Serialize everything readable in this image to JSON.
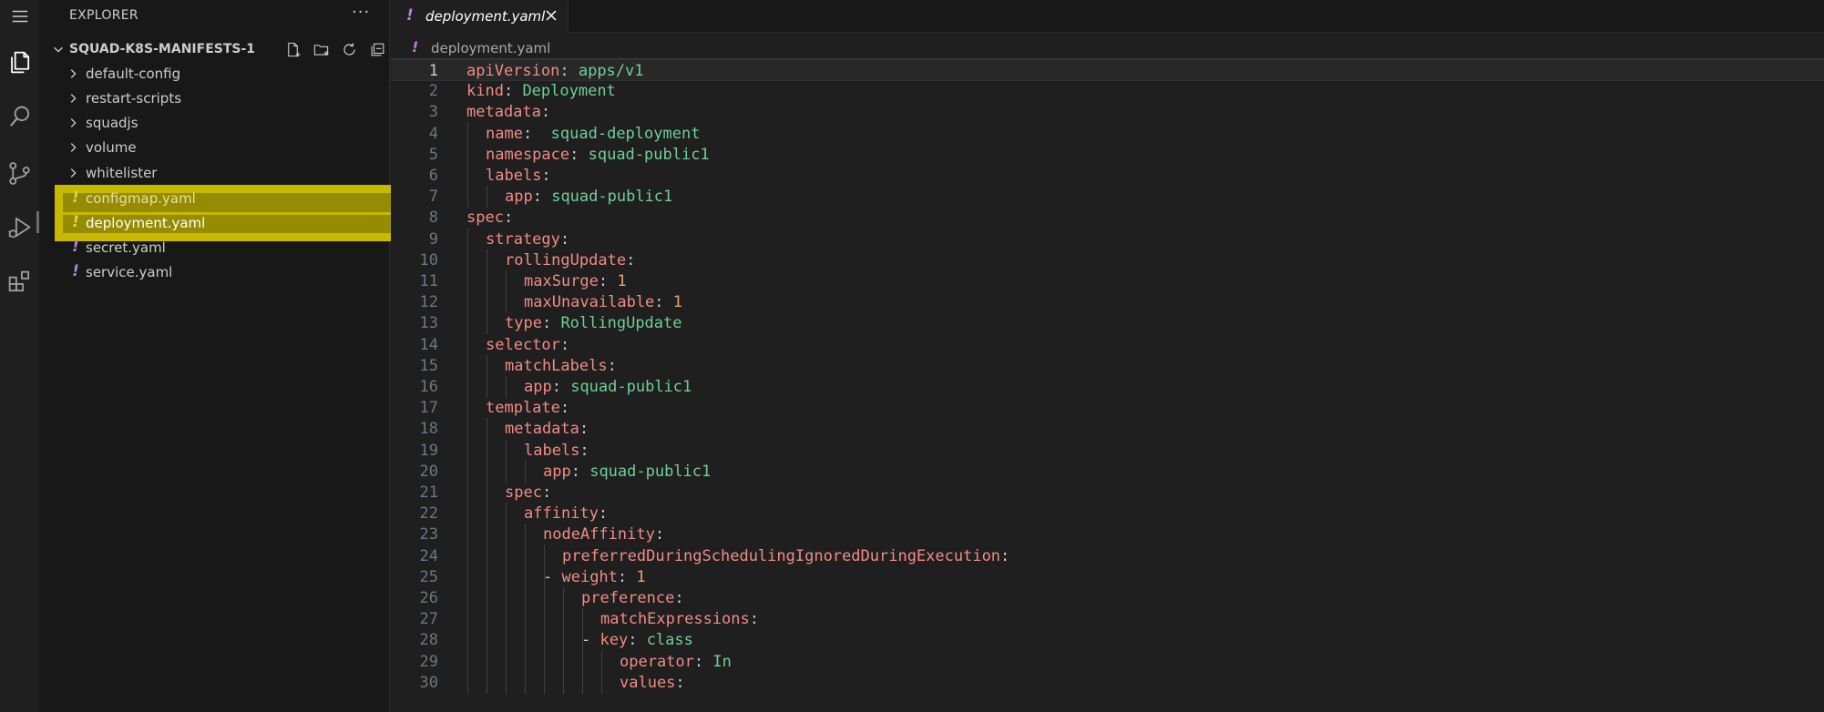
{
  "sidebar": {
    "title": "EXPLORER",
    "more": "···",
    "workspace": "SQUAD-K8S-MANIFESTS-1",
    "folders": [
      "default-config",
      "restart-scripts",
      "squadjs",
      "volume",
      "whitelister"
    ],
    "files": [
      {
        "icon": "!",
        "name": "configmap.yaml"
      },
      {
        "icon": "!",
        "name": "deployment.yaml"
      },
      {
        "icon": "!",
        "name": "secret.yaml"
      },
      {
        "icon": "!",
        "name": "service.yaml"
      }
    ]
  },
  "editor": {
    "tab_title": "deployment.yaml",
    "tab_icon": "!",
    "breadcrumb": "deployment.yaml",
    "lines": [
      {
        "num": "1",
        "key": "apiVersion",
        "val": "apps/v1"
      },
      {
        "num": "2",
        "key": "kind",
        "val": "Deployment"
      },
      {
        "num": "3",
        "key": "metadata",
        "val": ""
      },
      {
        "num": "4",
        "key": "name",
        "val": " squad-deployment"
      },
      {
        "num": "5",
        "key": "namespace",
        "val": "squad-public1"
      },
      {
        "num": "6",
        "key": "labels",
        "val": ""
      },
      {
        "num": "7",
        "key": "app",
        "val": "squad-public1"
      },
      {
        "num": "8",
        "key": "spec",
        "val": ""
      },
      {
        "num": "9",
        "key": "strategy",
        "val": ""
      },
      {
        "num": "10",
        "key": "rollingUpdate",
        "val": ""
      },
      {
        "num": "11",
        "key": "maxSurge",
        "val": "1"
      },
      {
        "num": "12",
        "key": "maxUnavailable",
        "val": "1"
      },
      {
        "num": "13",
        "key": "type",
        "val": "RollingUpdate"
      },
      {
        "num": "14",
        "key": "selector",
        "val": ""
      },
      {
        "num": "15",
        "key": "matchLabels",
        "val": ""
      },
      {
        "num": "16",
        "key": "app",
        "val": "squad-public1"
      },
      {
        "num": "17",
        "key": "template",
        "val": ""
      },
      {
        "num": "18",
        "key": "metadata",
        "val": ""
      },
      {
        "num": "19",
        "key": "labels",
        "val": ""
      },
      {
        "num": "20",
        "key": "app",
        "val": "squad-public1"
      },
      {
        "num": "21",
        "key": "spec",
        "val": ""
      },
      {
        "num": "22",
        "key": "affinity",
        "val": ""
      },
      {
        "num": "23",
        "key": "nodeAffinity",
        "val": ""
      },
      {
        "num": "24",
        "key": "preferredDuringSchedulingIgnoredDuringExecution",
        "val": ""
      },
      {
        "num": "25",
        "key": "weight",
        "val": "1",
        "dash": "- "
      },
      {
        "num": "26",
        "key": "preference",
        "val": ""
      },
      {
        "num": "27",
        "key": "matchExpressions",
        "val": ""
      },
      {
        "num": "28",
        "key": "key",
        "val": "class",
        "dash": "- "
      },
      {
        "num": "29",
        "key": "operator",
        "val": "In"
      },
      {
        "num": "30",
        "key": "values",
        "val": ""
      }
    ]
  }
}
